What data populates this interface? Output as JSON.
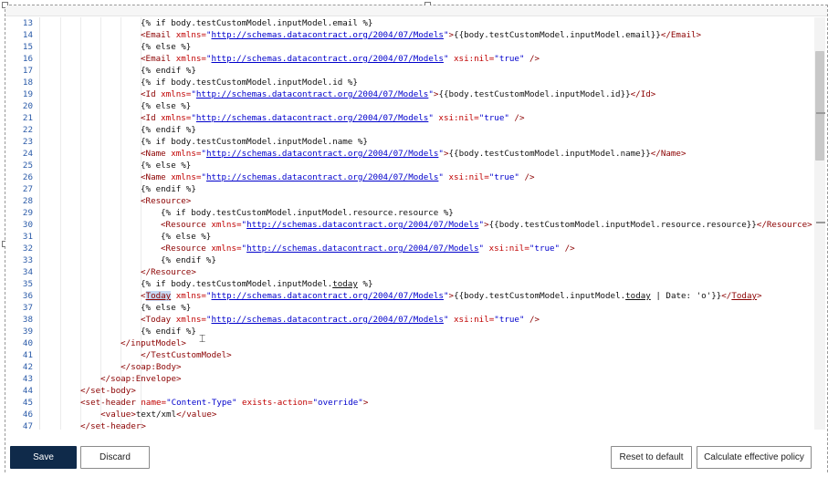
{
  "editor": {
    "lines": [
      {
        "n": "13",
        "indent": 3,
        "tokens": [
          {
            "t": "plain",
            "s": "{% if body.testCustomModel.inputModel.email %}"
          }
        ]
      },
      {
        "n": "14",
        "indent": 3,
        "tokens": [
          {
            "t": "tag",
            "s": "<Email "
          },
          {
            "t": "attr",
            "s": "xmlns="
          },
          {
            "t": "val",
            "s": "\""
          },
          {
            "t": "link",
            "s": "http://schemas.datacontract.org/2004/07/Models"
          },
          {
            "t": "val",
            "s": "\""
          },
          {
            "t": "tag",
            "s": ">"
          },
          {
            "t": "plain",
            "s": "{{body.testCustomModel.inputModel.email}}"
          },
          {
            "t": "tag",
            "s": "</Email>"
          }
        ]
      },
      {
        "n": "15",
        "indent": 3,
        "tokens": [
          {
            "t": "plain",
            "s": "{% else %}"
          }
        ]
      },
      {
        "n": "16",
        "indent": 3,
        "tokens": [
          {
            "t": "tag",
            "s": "<Email "
          },
          {
            "t": "attr",
            "s": "xmlns="
          },
          {
            "t": "val",
            "s": "\""
          },
          {
            "t": "link",
            "s": "http://schemas.datacontract.org/2004/07/Models"
          },
          {
            "t": "val",
            "s": "\" "
          },
          {
            "t": "attr",
            "s": "xsi:nil="
          },
          {
            "t": "val",
            "s": "\"true\""
          },
          {
            "t": "tag",
            "s": " />"
          }
        ]
      },
      {
        "n": "17",
        "indent": 3,
        "tokens": [
          {
            "t": "plain",
            "s": "{% endif %}"
          }
        ]
      },
      {
        "n": "18",
        "indent": 3,
        "tokens": [
          {
            "t": "plain",
            "s": "{% if body.testCustomModel.inputModel.id %}"
          }
        ]
      },
      {
        "n": "19",
        "indent": 3,
        "tokens": [
          {
            "t": "tag",
            "s": "<Id "
          },
          {
            "t": "attr",
            "s": "xmlns="
          },
          {
            "t": "val",
            "s": "\""
          },
          {
            "t": "link",
            "s": "http://schemas.datacontract.org/2004/07/Models"
          },
          {
            "t": "val",
            "s": "\""
          },
          {
            "t": "tag",
            "s": ">"
          },
          {
            "t": "plain",
            "s": "{{body.testCustomModel.inputModel.id}}"
          },
          {
            "t": "tag",
            "s": "</Id>"
          }
        ]
      },
      {
        "n": "20",
        "indent": 3,
        "tokens": [
          {
            "t": "plain",
            "s": "{% else %}"
          }
        ]
      },
      {
        "n": "21",
        "indent": 3,
        "tokens": [
          {
            "t": "tag",
            "s": "<Id "
          },
          {
            "t": "attr",
            "s": "xmlns="
          },
          {
            "t": "val",
            "s": "\""
          },
          {
            "t": "link",
            "s": "http://schemas.datacontract.org/2004/07/Models"
          },
          {
            "t": "val",
            "s": "\" "
          },
          {
            "t": "attr",
            "s": "xsi:nil="
          },
          {
            "t": "val",
            "s": "\"true\""
          },
          {
            "t": "tag",
            "s": " />"
          }
        ]
      },
      {
        "n": "22",
        "indent": 3,
        "tokens": [
          {
            "t": "plain",
            "s": "{% endif %}"
          }
        ]
      },
      {
        "n": "23",
        "indent": 3,
        "tokens": [
          {
            "t": "plain",
            "s": "{% if body.testCustomModel.inputModel.name %}"
          }
        ]
      },
      {
        "n": "24",
        "indent": 3,
        "tokens": [
          {
            "t": "tag",
            "s": "<Name "
          },
          {
            "t": "attr",
            "s": "xmlns="
          },
          {
            "t": "val",
            "s": "\""
          },
          {
            "t": "link",
            "s": "http://schemas.datacontract.org/2004/07/Models"
          },
          {
            "t": "val",
            "s": "\""
          },
          {
            "t": "tag",
            "s": ">"
          },
          {
            "t": "plain",
            "s": "{{body.testCustomModel.inputModel.name}}"
          },
          {
            "t": "tag",
            "s": "</Name>"
          }
        ]
      },
      {
        "n": "25",
        "indent": 3,
        "tokens": [
          {
            "t": "plain",
            "s": "{% else %}"
          }
        ]
      },
      {
        "n": "26",
        "indent": 3,
        "tokens": [
          {
            "t": "tag",
            "s": "<Name "
          },
          {
            "t": "attr",
            "s": "xmlns="
          },
          {
            "t": "val",
            "s": "\""
          },
          {
            "t": "link",
            "s": "http://schemas.datacontract.org/2004/07/Models"
          },
          {
            "t": "val",
            "s": "\" "
          },
          {
            "t": "attr",
            "s": "xsi:nil="
          },
          {
            "t": "val",
            "s": "\"true\""
          },
          {
            "t": "tag",
            "s": " />"
          }
        ]
      },
      {
        "n": "27",
        "indent": 3,
        "tokens": [
          {
            "t": "plain",
            "s": "{% endif %}"
          }
        ]
      },
      {
        "n": "28",
        "indent": 3,
        "tokens": [
          {
            "t": "tag",
            "s": "<Resource>"
          }
        ]
      },
      {
        "n": "29",
        "indent": 4,
        "tokens": [
          {
            "t": "plain",
            "s": "{% if body.testCustomModel.inputModel.resource.resource %}"
          }
        ]
      },
      {
        "n": "30",
        "indent": 4,
        "tokens": [
          {
            "t": "tag",
            "s": "<Resource "
          },
          {
            "t": "attr",
            "s": "xmlns="
          },
          {
            "t": "val",
            "s": "\""
          },
          {
            "t": "link",
            "s": "http://schemas.datacontract.org/2004/07/Models"
          },
          {
            "t": "val",
            "s": "\""
          },
          {
            "t": "tag",
            "s": ">"
          },
          {
            "t": "plain",
            "s": "{{body.testCustomModel.inputModel.resource.resource}}"
          },
          {
            "t": "tag",
            "s": "</Resource>"
          }
        ]
      },
      {
        "n": "31",
        "indent": 4,
        "tokens": [
          {
            "t": "plain",
            "s": "{% else %}"
          }
        ]
      },
      {
        "n": "32",
        "indent": 4,
        "tokens": [
          {
            "t": "tag",
            "s": "<Resource "
          },
          {
            "t": "attr",
            "s": "xmlns="
          },
          {
            "t": "val",
            "s": "\""
          },
          {
            "t": "link",
            "s": "http://schemas.datacontract.org/2004/07/Models"
          },
          {
            "t": "val",
            "s": "\" "
          },
          {
            "t": "attr",
            "s": "xsi:nil="
          },
          {
            "t": "val",
            "s": "\"true\""
          },
          {
            "t": "tag",
            "s": " />"
          }
        ]
      },
      {
        "n": "33",
        "indent": 4,
        "tokens": [
          {
            "t": "plain",
            "s": "{% endif %}"
          }
        ]
      },
      {
        "n": "34",
        "indent": 3,
        "tokens": [
          {
            "t": "tag",
            "s": "</Resource>"
          }
        ]
      },
      {
        "n": "35",
        "indent": 3,
        "tokens": [
          {
            "t": "plain",
            "s": "{% if body.testCustomModel.inputModel."
          },
          {
            "t": "plainul",
            "s": "today"
          },
          {
            "t": "plain",
            "s": " %}"
          }
        ]
      },
      {
        "n": "36",
        "indent": 3,
        "tokens": [
          {
            "t": "tag",
            "s": "<"
          },
          {
            "t": "taghl",
            "s": "Today"
          },
          {
            "t": "tag",
            "s": " "
          },
          {
            "t": "attr",
            "s": "xmlns="
          },
          {
            "t": "val",
            "s": "\""
          },
          {
            "t": "link",
            "s": "http://schemas.datacontract.org/2004/07/Models"
          },
          {
            "t": "val",
            "s": "\""
          },
          {
            "t": "tag",
            "s": ">"
          },
          {
            "t": "plain",
            "s": "{{body.testCustomModel.inputModel."
          },
          {
            "t": "plainul",
            "s": "today"
          },
          {
            "t": "plain",
            "s": " | Date: 'o'}}"
          },
          {
            "t": "tag",
            "s": "</"
          },
          {
            "t": "tagul",
            "s": "Today"
          },
          {
            "t": "tag",
            "s": ">"
          }
        ]
      },
      {
        "n": "37",
        "indent": 3,
        "tokens": [
          {
            "t": "plain",
            "s": "{% else %}"
          }
        ]
      },
      {
        "n": "38",
        "indent": 3,
        "tokens": [
          {
            "t": "tag",
            "s": "<Today "
          },
          {
            "t": "attr",
            "s": "xmlns="
          },
          {
            "t": "val",
            "s": "\""
          },
          {
            "t": "link",
            "s": "http://schemas.datacontract.org/2004/07/Models"
          },
          {
            "t": "val",
            "s": "\" "
          },
          {
            "t": "attr",
            "s": "xsi:nil="
          },
          {
            "t": "val",
            "s": "\"true\""
          },
          {
            "t": "tag",
            "s": " />"
          }
        ]
      },
      {
        "n": "39",
        "indent": 3,
        "tokens": [
          {
            "t": "plain",
            "s": "{% endif %}"
          }
        ]
      },
      {
        "n": "40",
        "indent": 2,
        "tokens": [
          {
            "t": "tag",
            "s": "</inputModel>"
          }
        ]
      },
      {
        "n": "41",
        "indent": 2,
        "tokens": [
          {
            "t": "tag",
            "s": "    </TestCustomModel>"
          }
        ]
      },
      {
        "n": "42",
        "indent": 1,
        "tokens": [
          {
            "t": "tag",
            "s": "    </soap:Body>"
          }
        ]
      },
      {
        "n": "43",
        "indent": 1,
        "tokens": [
          {
            "t": "tag",
            "s": "</soap:Envelope>"
          }
        ]
      },
      {
        "n": "44",
        "indent": 0,
        "tokens": [
          {
            "t": "tag",
            "s": "</set-body>"
          }
        ]
      },
      {
        "n": "45",
        "indent": 0,
        "tokens": [
          {
            "t": "tag",
            "s": "<set-header "
          },
          {
            "t": "attr",
            "s": "name="
          },
          {
            "t": "val",
            "s": "\"Content-Type\" "
          },
          {
            "t": "attr",
            "s": "exists-action="
          },
          {
            "t": "val",
            "s": "\"override\""
          },
          {
            "t": "tag",
            "s": ">"
          }
        ]
      },
      {
        "n": "46",
        "indent": 0,
        "tokens": [
          {
            "t": "tag",
            "s": "    <value>"
          },
          {
            "t": "plain",
            "s": "text/xml"
          },
          {
            "t": "tag",
            "s": "</value>"
          }
        ]
      },
      {
        "n": "47",
        "indent": 0,
        "tokens": [
          {
            "t": "tag",
            "s": "</set-header>"
          }
        ]
      }
    ]
  },
  "footer": {
    "save_label": "Save",
    "discard_label": "Discard",
    "reset_label": "Reset to default",
    "calculate_label": "Calculate effective policy"
  },
  "colors": {
    "save_bg": "#0f2a4a",
    "tag": "#8b0000",
    "attr": "#c00000",
    "link": "#0000cc",
    "line_number": "#2a5aa8"
  },
  "icons": {
    "cursor": "text-cursor-icon"
  }
}
